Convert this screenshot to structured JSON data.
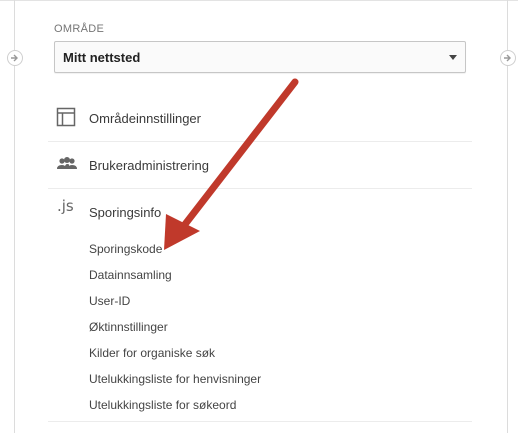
{
  "section_label": "OMRÅDE",
  "property_select": {
    "value": "Mitt nettsted"
  },
  "nav": {
    "items": [
      {
        "label": "Områdeinnstillinger",
        "icon": "layout-icon"
      },
      {
        "label": "Brukeradministrering",
        "icon": "people-icon"
      },
      {
        "label": "Sporingsinfo",
        "icon": "js-icon",
        "icon_text": ".js"
      }
    ],
    "tracking_subitems": [
      "Sporingskode",
      "Datainnsamling",
      "User-ID",
      "Øktinnstillinger",
      "Kilder for organiske søk",
      "Utelukkingsliste for henvisninger",
      "Utelukkingsliste for søkeord"
    ]
  },
  "annotation": {
    "color": "#c0392b"
  }
}
